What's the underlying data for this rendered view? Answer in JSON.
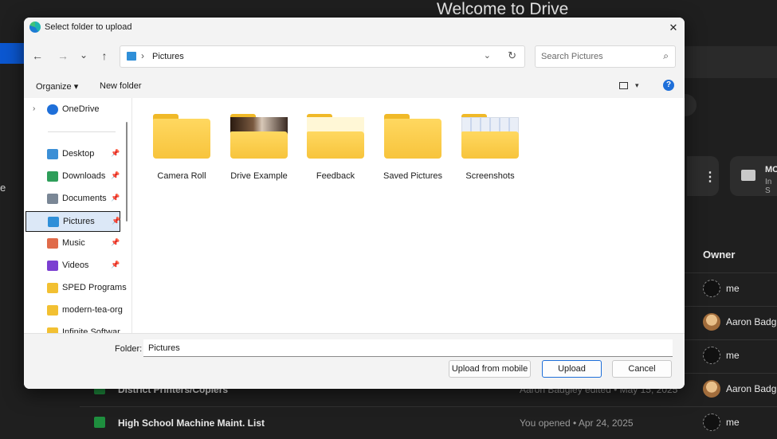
{
  "background": {
    "page_title": "Welcome to Drive",
    "edge_letter": "e",
    "card_title": "MC",
    "card_sub": "In S",
    "owner_header": "Owner",
    "rows": [
      {
        "name": "",
        "meta": "",
        "owner": "me",
        "avatar": "dark"
      },
      {
        "name": "",
        "meta": "",
        "owner": "Aaron Badg",
        "avatar": "photo"
      },
      {
        "name": "",
        "meta": "",
        "owner": "me",
        "avatar": "dark"
      },
      {
        "name": "District Printers/Copiers",
        "meta": "Aaron Badgley edited • May 15, 2025",
        "owner": "Aaron Badg",
        "avatar": "photo"
      },
      {
        "name": "High School Machine Maint. List",
        "meta": "You opened • Apr 24, 2025",
        "owner": "me",
        "avatar": "dark"
      }
    ]
  },
  "dialog": {
    "title": "Select folder to upload",
    "close_glyph": "✕",
    "nav": {
      "back": "←",
      "forward": "→",
      "recent": "⌄",
      "up": "↑"
    },
    "address": {
      "separator": "›",
      "path": "Pictures",
      "dropdown": "⌄",
      "refresh": "↻"
    },
    "search": {
      "placeholder": "Search Pictures",
      "icon": "⌕"
    },
    "toolbar": {
      "organize": "Organize ▾",
      "new_folder": "New folder",
      "view_caret": "▾",
      "help": "?"
    },
    "sidebar": [
      {
        "label": "OneDrive",
        "icon_color": "#1e6fd9",
        "pinned": false,
        "selected": false,
        "chevron": "›"
      },
      {
        "label": "Desktop",
        "icon_color": "#3b8fd6",
        "pinned": true,
        "selected": false
      },
      {
        "label": "Downloads",
        "icon_color": "#2e9e5a",
        "pinned": true,
        "selected": false
      },
      {
        "label": "Documents",
        "icon_color": "#7a8796",
        "pinned": true,
        "selected": false
      },
      {
        "label": "Pictures",
        "icon_color": "#2f8fd8",
        "pinned": true,
        "selected": true
      },
      {
        "label": "Music",
        "icon_color": "#e06b4a",
        "pinned": true,
        "selected": false
      },
      {
        "label": "Videos",
        "icon_color": "#7b3fd1",
        "pinned": true,
        "selected": false
      },
      {
        "label": "SPED Programs",
        "icon_color": "#f2c032",
        "pinned": false,
        "selected": false
      },
      {
        "label": "modern-tea-org",
        "icon_color": "#f2c032",
        "pinned": false,
        "selected": false
      },
      {
        "label": "Infinite Softwar",
        "icon_color": "#f2c032",
        "pinned": false,
        "selected": false
      }
    ],
    "pin_glyph": "📌",
    "folders": [
      {
        "label": "Camera Roll",
        "preview": "none"
      },
      {
        "label": "Drive Example",
        "preview": "drive"
      },
      {
        "label": "Feedback",
        "preview": "feed"
      },
      {
        "label": "Saved Pictures",
        "preview": "none"
      },
      {
        "label": "Screenshots",
        "preview": "shots"
      }
    ],
    "footer": {
      "folder_label": "Folder:",
      "folder_value": "Pictures",
      "upload_mobile": "Upload from mobile",
      "upload": "Upload",
      "cancel": "Cancel"
    }
  }
}
